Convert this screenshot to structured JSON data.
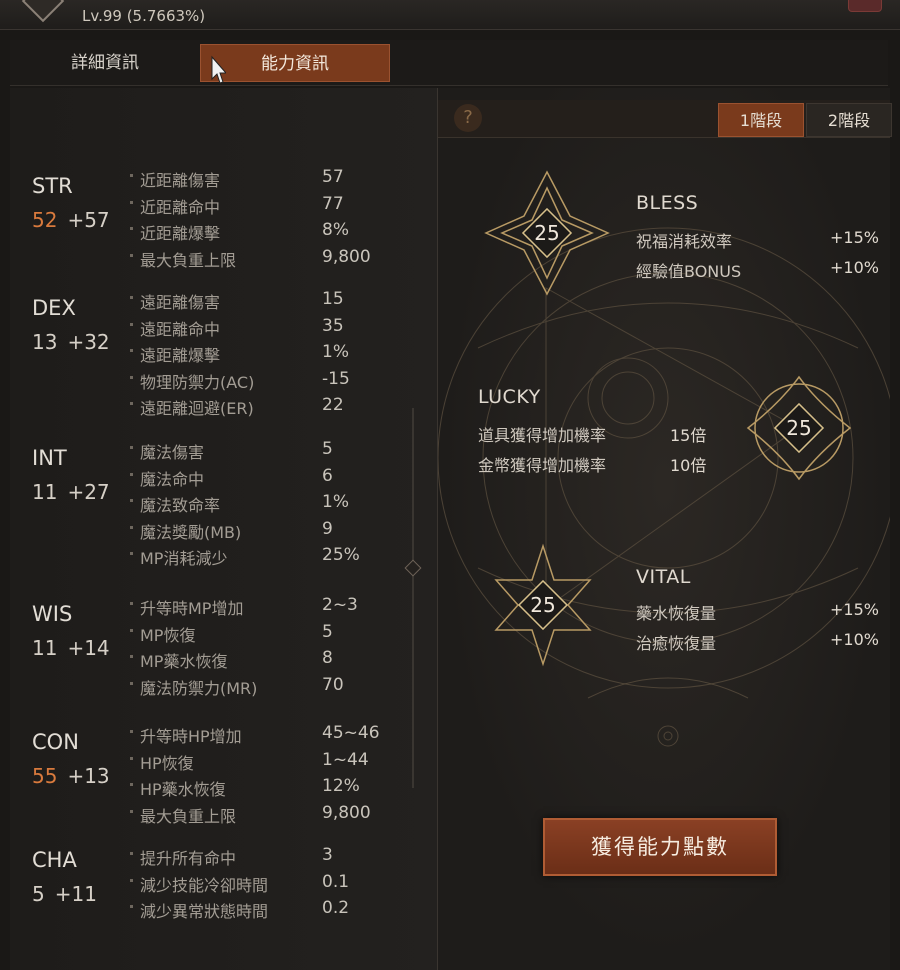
{
  "header": {
    "level_text": "Lv.99 (5.7663%)"
  },
  "tabs": [
    {
      "label": "詳細資訊"
    },
    {
      "label": "能力資訊"
    }
  ],
  "stats": [
    {
      "name": "STR",
      "base": "52",
      "bonus": "+57",
      "base_highlight": true,
      "rows": [
        {
          "label": "近距離傷害",
          "value": "57"
        },
        {
          "label": "近距離命中",
          "value": "77"
        },
        {
          "label": "近距離爆擊",
          "value": "8%"
        },
        {
          "label": "最大負重上限",
          "value": "9,800"
        }
      ]
    },
    {
      "name": "DEX",
      "base": "13",
      "bonus": "+32",
      "base_highlight": false,
      "rows": [
        {
          "label": "遠距離傷害",
          "value": "15"
        },
        {
          "label": "遠距離命中",
          "value": "35"
        },
        {
          "label": "遠距離爆擊",
          "value": "1%"
        },
        {
          "label": "物理防禦力(AC)",
          "value": "-15"
        },
        {
          "label": "遠距離迴避(ER)",
          "value": "22"
        }
      ]
    },
    {
      "name": "INT",
      "base": "11",
      "bonus": "+27",
      "base_highlight": false,
      "rows": [
        {
          "label": "魔法傷害",
          "value": "5"
        },
        {
          "label": "魔法命中",
          "value": "6"
        },
        {
          "label": "魔法致命率",
          "value": "1%"
        },
        {
          "label": "魔法獎勵(MB)",
          "value": "9"
        },
        {
          "label": "MP消耗減少",
          "value": "25%"
        }
      ]
    },
    {
      "name": "WIS",
      "base": "11",
      "bonus": "+14",
      "base_highlight": false,
      "rows": [
        {
          "label": "升等時MP增加",
          "value": "2~3"
        },
        {
          "label": "MP恢復",
          "value": "5"
        },
        {
          "label": "MP藥水恢復",
          "value": "8"
        },
        {
          "label": "魔法防禦力(MR)",
          "value": "70"
        }
      ]
    },
    {
      "name": "CON",
      "base": "55",
      "bonus": "+13",
      "base_highlight": true,
      "rows": [
        {
          "label": "升等時HP增加",
          "value": "45~46"
        },
        {
          "label": "HP恢復",
          "value": "1~44"
        },
        {
          "label": "HP藥水恢復",
          "value": "12%"
        },
        {
          "label": "最大負重上限",
          "value": "9,800"
        }
      ]
    },
    {
      "name": "CHA",
      "base": "5",
      "bonus": "+11",
      "base_highlight": false,
      "rows": [
        {
          "label": "提升所有命中",
          "value": "3"
        },
        {
          "label": "減少技能冷卻時間",
          "value": "0.1"
        },
        {
          "label": "減少異常狀態時間",
          "value": "0.2"
        }
      ]
    }
  ],
  "right": {
    "help_icon": "?",
    "stage_tabs": [
      "1階段",
      "2階段"
    ],
    "bless": {
      "points": "25",
      "title": "BLESS",
      "rows": [
        {
          "label": "祝福消耗效率",
          "value": "+15%"
        },
        {
          "label": "經驗值BONUS",
          "value": "+10%"
        }
      ]
    },
    "lucky": {
      "points": "25",
      "title": "LUCKY",
      "rows": [
        {
          "label": "道具獲得增加機率",
          "value": "15倍"
        },
        {
          "label": "金幣獲得增加機率",
          "value": "10倍"
        }
      ]
    },
    "vital": {
      "points": "25",
      "title": "VITAL",
      "rows": [
        {
          "label": "藥水恢復量",
          "value": "+15%"
        },
        {
          "label": "治癒恢復量",
          "value": "+10%"
        }
      ]
    },
    "gain_button": "獲得能力點數"
  },
  "colors": {
    "accent": "#7a3a1c",
    "highlight_stat": "#d97a3d",
    "gold": "#b89a64"
  }
}
